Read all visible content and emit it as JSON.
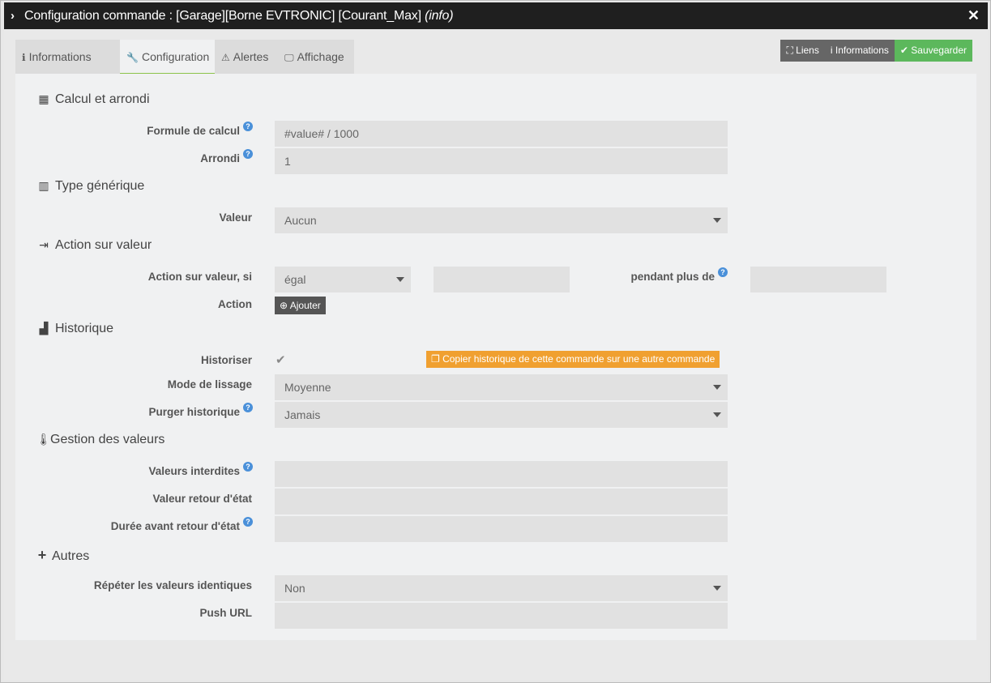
{
  "titlebar": {
    "prefix": "Configuration commande : [Garage][Borne EVTRONIC] [Courant_Max]",
    "suffix": "(info)",
    "chevron_icon": "chevron-right-icon",
    "close_icon": "close-icon"
  },
  "tabs": [
    {
      "label": "Informations",
      "icon": "info-circle-icon"
    },
    {
      "label": "Configuration",
      "icon": "wrench-icon"
    },
    {
      "label": "Alertes",
      "icon": "warning-icon"
    },
    {
      "label": "Affichage",
      "icon": "monitor-icon"
    }
  ],
  "active_tab": "Configuration",
  "toolbar": {
    "liens": "Liens",
    "informations": "Informations",
    "sauvegarder": "Sauvegarder"
  },
  "sections": {
    "calcul": "Calcul et arrondi",
    "type": "Type générique",
    "action": "Action sur valeur",
    "historique": "Historique",
    "gestion": "Gestion des valeurs",
    "autres": "Autres"
  },
  "fields": {
    "formule_label": "Formule de calcul",
    "formule_value": "#value# / 1000",
    "arrondi_label": "Arrondi",
    "arrondi_value": "1",
    "valeur_label": "Valeur",
    "valeur_value": "Aucun",
    "action_si_label": "Action sur valeur, si",
    "action_si_value": "égal",
    "action_si_input": "",
    "pendant_label": "pendant plus de",
    "pendant_value": "",
    "action_label": "Action",
    "ajouter": "Ajouter",
    "historiser_label": "Historiser",
    "copy_button": "Copier historique de cette commande sur une autre commande",
    "lissage_label": "Mode de lissage",
    "lissage_value": "Moyenne",
    "purger_label": "Purger historique",
    "purger_value": "Jamais",
    "interdites_label": "Valeurs interdites",
    "interdites_value": "",
    "retour_label": "Valeur retour d'état",
    "retour_value": "",
    "duree_label": "Durée avant retour d'état",
    "duree_value": "",
    "repeter_label": "Répéter les valeurs identiques",
    "repeter_value": "Non",
    "push_label": "Push URL",
    "push_value": ""
  }
}
